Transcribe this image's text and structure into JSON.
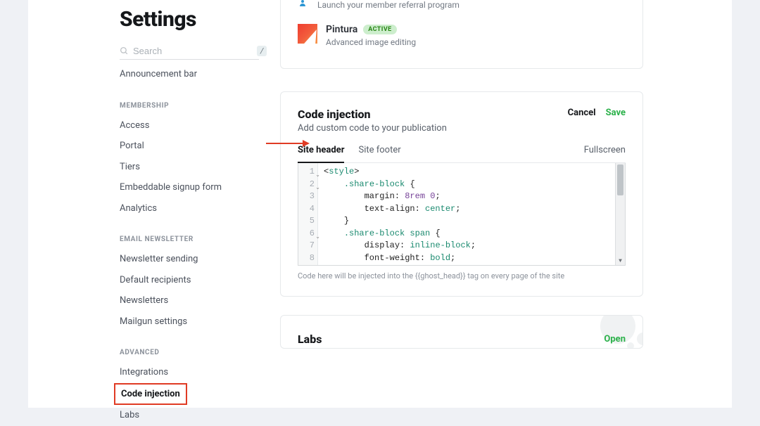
{
  "page_title": "Settings",
  "search": {
    "placeholder": "Search",
    "shortcut": "/"
  },
  "sidebar": {
    "top_item": "Announcement bar",
    "sections": [
      {
        "header": "MEMBERSHIP",
        "items": [
          "Access",
          "Portal",
          "Tiers",
          "Embeddable signup form",
          "Analytics"
        ]
      },
      {
        "header": "EMAIL NEWSLETTER",
        "items": [
          "Newsletter sending",
          "Default recipients",
          "Newsletters",
          "Mailgun settings"
        ]
      },
      {
        "header": "ADVANCED",
        "items": [
          "Integrations",
          "Code injection",
          "Labs"
        ],
        "highlighted_index": 1
      }
    ]
  },
  "referral": {
    "text": "Launch your member referral program"
  },
  "integration": {
    "name": "Pintura",
    "badge": "ACTIVE",
    "desc": "Advanced image editing"
  },
  "code_injection": {
    "title": "Code injection",
    "desc": "Add custom code to your publication",
    "cancel": "Cancel",
    "save": "Save",
    "tabs": [
      "Site header",
      "Site footer"
    ],
    "active_tab": 0,
    "fullscreen": "Fullscreen",
    "line_numbers": [
      "1",
      "2",
      "3",
      "4",
      "5",
      "6",
      "7",
      "8"
    ],
    "code_lines": [
      {
        "raw": "<style>",
        "type": "tag"
      },
      {
        "raw": "    .share-block {",
        "type": "sel"
      },
      {
        "raw": "        margin: 8rem 0;",
        "type": "prop-num"
      },
      {
        "raw": "        text-align: center;",
        "type": "prop-kw"
      },
      {
        "raw": "    }",
        "type": "punc"
      },
      {
        "raw": "    .share-block span {",
        "type": "sel"
      },
      {
        "raw": "        display: inline-block;",
        "type": "prop-kw"
      },
      {
        "raw": "        font-weight: bold;",
        "type": "prop-kw"
      }
    ],
    "hint": "Code here will be injected into the {{ghost_head}} tag on every page of the site"
  },
  "labs": {
    "title": "Labs",
    "open": "Open"
  }
}
